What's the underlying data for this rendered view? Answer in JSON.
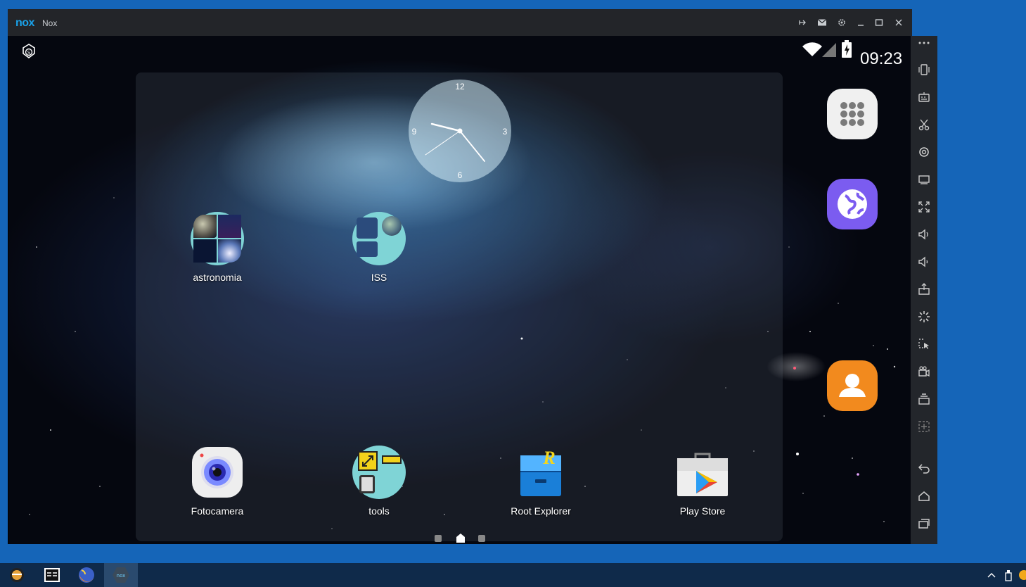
{
  "window": {
    "logo": "nox",
    "title": "Nox",
    "controls": [
      "pin-icon",
      "mail-icon",
      "settings-icon",
      "minimize-icon",
      "maximize-icon",
      "close-icon"
    ]
  },
  "status_bar": {
    "time": "09:23"
  },
  "clock": {
    "n12": "12",
    "n3": "3",
    "n6": "6",
    "n9": "9"
  },
  "apps": {
    "astronomia": "astronomia",
    "iss": "ISS",
    "fotocamera": "Fotocamera",
    "tools": "tools",
    "root_explorer": "Root Explorer",
    "play_store": "Play Store"
  },
  "dock": [
    "apps-grid-icon",
    "browser-icon",
    "contacts-icon"
  ],
  "sidebar": [
    "more-icon",
    "shake-icon",
    "keyboard-icon",
    "scissors-icon",
    "location-icon",
    "screen-icon",
    "fullscreen-icon",
    "volume-up-icon",
    "volume-down-icon",
    "apk-install-icon",
    "loading-icon",
    "shortcut-icon",
    "record-icon",
    "multi-instance-icon",
    "add-icon",
    "back-icon",
    "home-icon",
    "recent-apps-icon"
  ],
  "taskbar": [
    "app1-icon",
    "app2-icon",
    "firefox-icon",
    "nox-icon"
  ],
  "colors": {
    "desktop": "#1565b8",
    "titlebar": "#232529",
    "nox_blue": "#1aa1e8",
    "dock_browser": "#7b5cf0",
    "dock_contacts": "#f28a1e"
  }
}
